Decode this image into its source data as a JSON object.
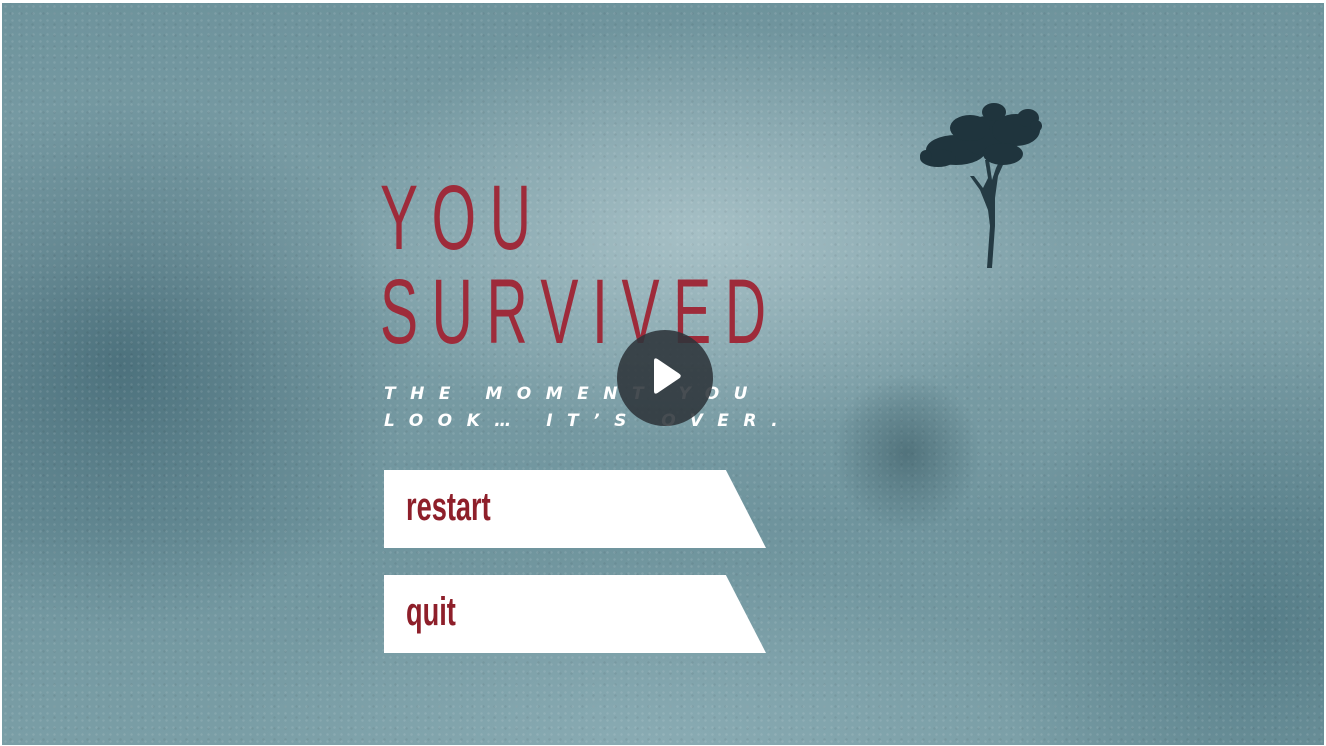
{
  "scene": {
    "title_line1": "YOU",
    "title_line2": "SURVIVED",
    "subtitle_line1": "THE MOMENT YOU",
    "subtitle_line2": "LOOK… IT’S OVER."
  },
  "menu": {
    "restart_label": "restart",
    "quit_label": "quit"
  },
  "video": {
    "play_icon": "play-icon"
  },
  "colors": {
    "title": "#9e2b3a",
    "button_text": "#8e1f2a",
    "button_bg": "#ffffff",
    "subtitle": "#ffffff"
  }
}
